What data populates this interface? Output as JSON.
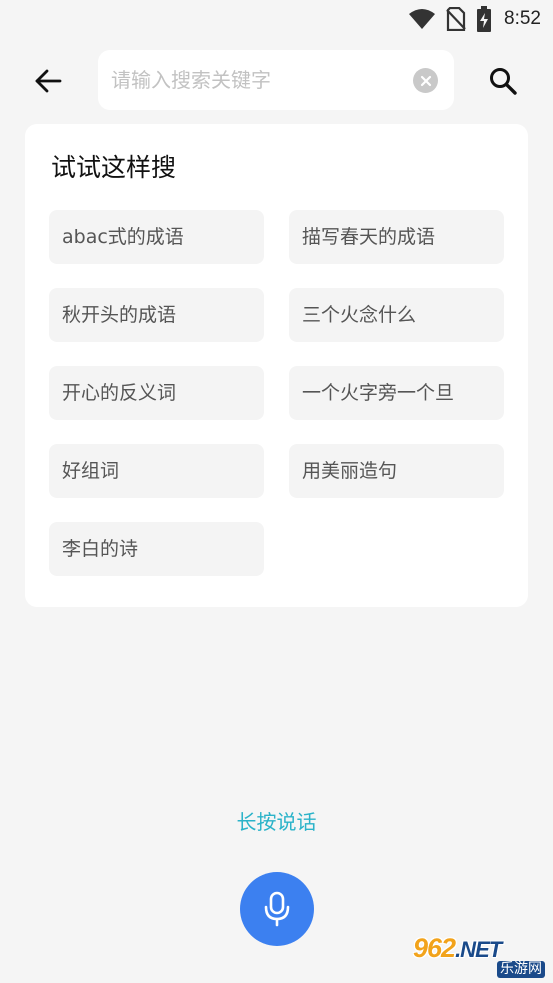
{
  "status_bar": {
    "time": "8:52",
    "icons": [
      "wifi-icon",
      "no-sim-icon",
      "battery-charging-icon"
    ]
  },
  "search": {
    "placeholder": "请输入搜索关键字",
    "value": "",
    "back_icon": "arrow-left-icon",
    "clear_icon": "clear-circle-icon",
    "search_icon": "search-icon"
  },
  "suggestions": {
    "title": "试试这样搜",
    "items": [
      "abac式的成语",
      "描写春天的成语",
      "秋开头的成语",
      "三个火念什么",
      "开心的反义词",
      "一个火字旁一个旦",
      "好组词",
      "用美丽造句",
      "李白的诗"
    ]
  },
  "voice": {
    "hint": "长按说话",
    "icon": "microphone-icon"
  },
  "watermark": {
    "main": "962",
    "net": ".NET",
    "sub": "乐游网"
  },
  "colors": {
    "background": "#f5f5f5",
    "card": "#ffffff",
    "chip": "#f4f4f4",
    "accent_text": "#2bb3c9",
    "mic_button": "#3c80f0"
  }
}
